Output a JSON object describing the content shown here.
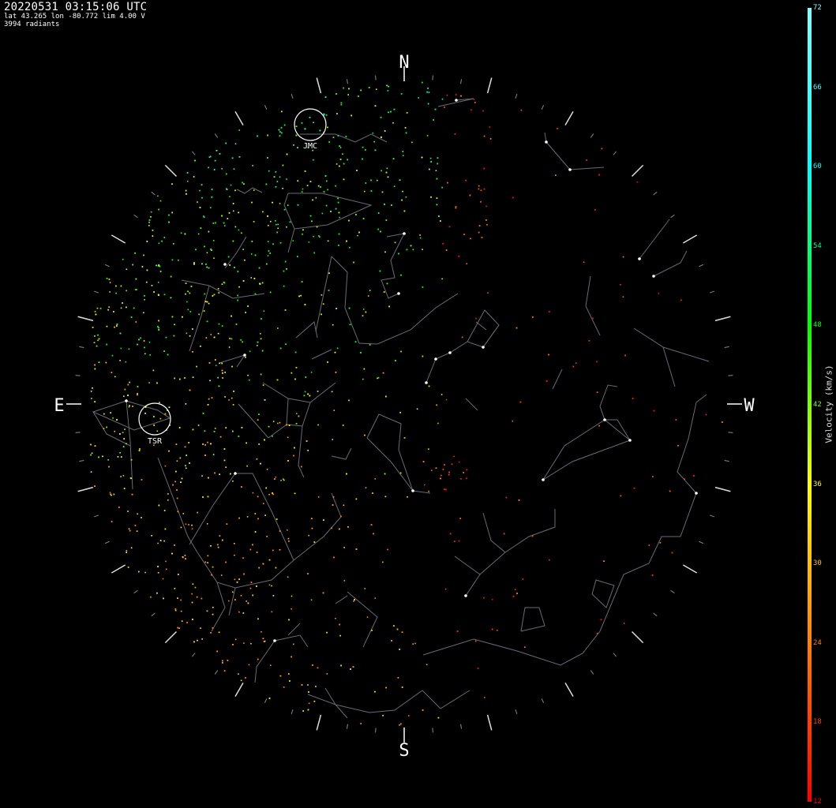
{
  "header": {
    "title": "20220531 03:15:06 UTC",
    "location": "lat 43.265 lon -80.772 lim 4.00 V",
    "count": "3994 radiants"
  },
  "compass": {
    "north": "N",
    "south": "S",
    "east": "E",
    "west": "W"
  },
  "showers": [
    {
      "code": "JMC"
    },
    {
      "code": "TSR"
    }
  ],
  "colorbar": {
    "label": "Velocity (km/s)",
    "min": 12,
    "max": 72,
    "ticks": [
      "72",
      "66",
      "60",
      "54",
      "48",
      "42",
      "36",
      "30",
      "24",
      "18",
      "12"
    ],
    "colors": [
      "#ff0000",
      "#ff8000",
      "#ffff00",
      "#00ff00",
      "#00ffff",
      "#80ffff"
    ]
  }
}
